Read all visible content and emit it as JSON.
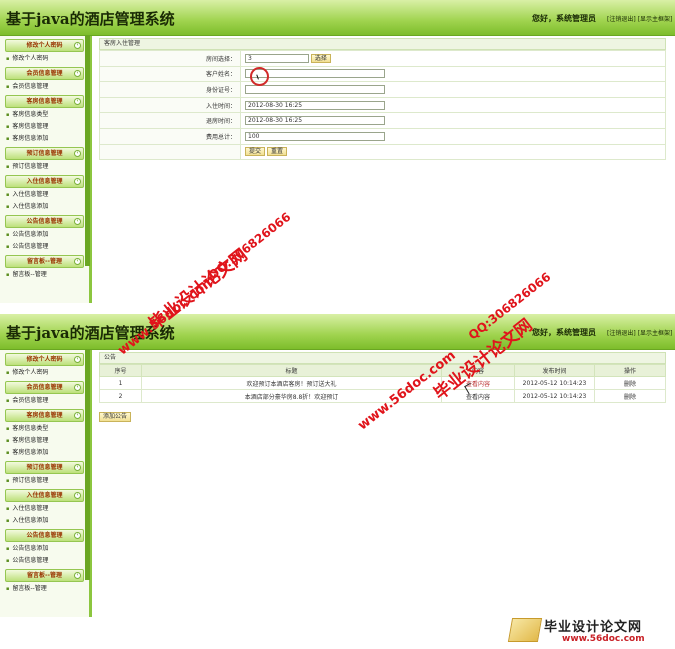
{
  "app": {
    "title": "基于java的酒店管理系统",
    "greeting": "您好，系统管理员",
    "links": [
      "[注销退出]",
      "[显示主框架]"
    ]
  },
  "sidebar": [
    {
      "header": "修改个人密码",
      "items": [
        "修改个人密码"
      ]
    },
    {
      "header": "会员信息管理",
      "items": [
        "会员信息管理"
      ]
    },
    {
      "header": "客房信息管理",
      "items": [
        "客房信息类型",
        "客房信息管理",
        "客房信息添加"
      ]
    },
    {
      "header": "预订信息管理",
      "items": [
        "预订信息管理"
      ]
    },
    {
      "header": "入住信息管理",
      "items": [
        "入住信息管理",
        "入住信息添加"
      ]
    },
    {
      "header": "公告信息管理",
      "items": [
        "公告信息添加",
        "公告信息管理"
      ]
    },
    {
      "header": "留言板--管理",
      "items": [
        "留言板--管理"
      ]
    }
  ],
  "checkin_form": {
    "panel_title": "客房入住管理",
    "room_label": "房间选择：",
    "room_value": "3",
    "select_button": "选择",
    "name_label": "客户姓名：",
    "name_value": "",
    "id_label": "身份证号：",
    "id_value": "",
    "checkin_label": "入住时间：",
    "checkin_value": "2012-08-30 16:25",
    "checkout_label": "退房时间：",
    "checkout_value": "2012-08-30 16:25",
    "fee_label": "费用总计：",
    "fee_value": "100",
    "submit_button": "提交",
    "reset_button": "重置"
  },
  "notice_list": {
    "panel_title": "公告",
    "columns": [
      "序号",
      "标题",
      "内容",
      "发布时间",
      "操作"
    ],
    "rows": [
      {
        "no": "1",
        "title": "欢迎预订本酒店客房！预订送大礼",
        "content": "查看内容",
        "time": "2012-05-12 10:14:23",
        "action": "删除"
      },
      {
        "no": "2",
        "title": "本酒店部分豪华房8.8折！欢迎预订",
        "content": "查看内容",
        "time": "2012-05-12 10:14:23",
        "action": "删除"
      }
    ],
    "add_button": "添加公告"
  },
  "watermarks": {
    "site_name": "毕业设计论文网",
    "url": "www.56doc.com",
    "qq": "QQ:306826066"
  },
  "footer_logo": {
    "name": "毕业设计论文网",
    "url": "www.56doc.com"
  },
  "colors": {
    "header_green": "#9fd34e",
    "menu_text": "#993300",
    "watermark_red": "#e0141b"
  }
}
